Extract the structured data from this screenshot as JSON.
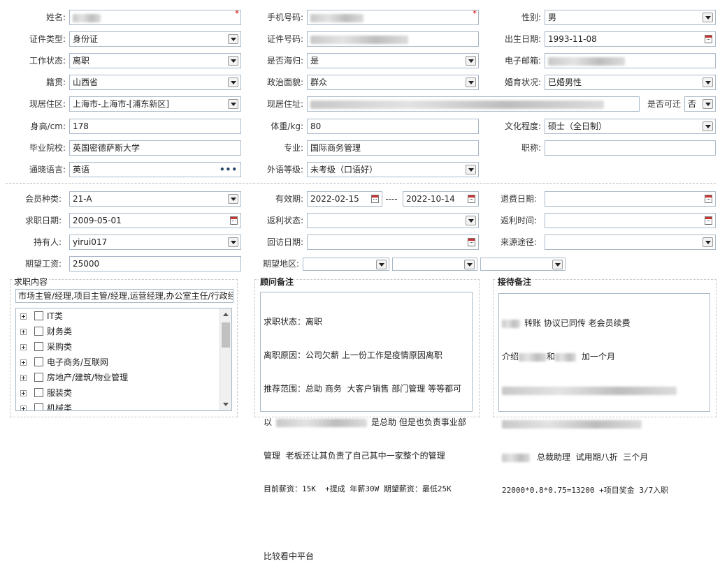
{
  "form": {
    "name_label": "姓名:",
    "phone_label": "手机号码:",
    "gender_label": "性别:",
    "gender_value": "男",
    "id_type_label": "证件类型:",
    "id_type_value": "身份证",
    "id_no_label": "证件号码:",
    "birth_label": "出生日期:",
    "birth_value": "1993-11-08",
    "work_status_label": "工作状态:",
    "work_status_value": "离职",
    "returnee_label": "是否海归:",
    "returnee_value": "是",
    "email_label": "电子邮箱:",
    "native_label": "籍贯:",
    "native_value": "山西省",
    "political_label": "政治面貌:",
    "political_value": "群众",
    "marital_label": "婚育状况:",
    "marital_value": "已婚男性",
    "residence_label": "现居住区:",
    "residence_value": "上海市-上海市-[浦东新区]",
    "address_label": "现居住址:",
    "relocate_label": "是否可迁",
    "relocate_value": "否",
    "height_label": "身高/cm:",
    "height_value": "178",
    "weight_label": "体重/kg:",
    "weight_value": "80",
    "education_label": "文化程度:",
    "education_value": "硕士（全日制）",
    "school_label": "毕业院校:",
    "school_value": "英国密德萨斯大学",
    "major_label": "专业:",
    "major_value": "国际商务管理",
    "title_label": "职称:",
    "title_value": "",
    "language_label": "通晓语言:",
    "language_value": "英语",
    "lang_level_label": "外语等级:",
    "lang_level_value": "未考级（口语好）"
  },
  "member": {
    "type_label": "会员种类:",
    "type_value": "21-A",
    "valid_label": "有效期:",
    "valid_from": "2022-02-15",
    "valid_sep": "----",
    "valid_to": "2022-10-14",
    "refund_date_label": "退费日期:",
    "job_date_label": "求职日期:",
    "job_date_value": "2009-05-01",
    "rebate_status_label": "返利状态:",
    "rebate_time_label": "返利时间:",
    "holder_label": "持有人:",
    "holder_value": "yirui017",
    "visit_date_label": "回访日期:",
    "source_label": "来源途径:",
    "salary_label": "期望工资:",
    "salary_value": "25000",
    "region_label": "期望地区:"
  },
  "job_panel": {
    "title": "求职内容",
    "summary": "市场主管/经理,项目主管/经理,运营经理,办公室主任/行政经",
    "categories": [
      "IT类",
      "财务类",
      "采购类",
      "电子商务/互联网",
      "房地产/建筑/物业管理",
      "服装类",
      "机械类"
    ]
  },
  "advisor_panel": {
    "title": "顾问备注",
    "line1": "求职状态：离职",
    "line2": "离职原因：公司欠薪 上一份工作是疫情原因离职",
    "line3": "推荐范围：总助 商务  大客户销售 部门管理 等等都可",
    "line4a": "以",
    "line4b": "是总助 但是也负责事业部",
    "line5": "管理  老板还让其负责了自己其中一家整个的管理",
    "line6": "目前薪资：15K  +提成 年薪30W 期望薪资：最低25K",
    "line7": "比较看中平台"
  },
  "reception_panel": {
    "title": "接待备注",
    "line1": "转账 协议已同传 老会员续费",
    "line2a": "介绍",
    "line2b": "和",
    "line2c": "加一个月",
    "line5": "总裁助理  试用期八折  三个月",
    "line6": "22000*0.8*0.75=13200 +项目奖金 3/7入职"
  }
}
